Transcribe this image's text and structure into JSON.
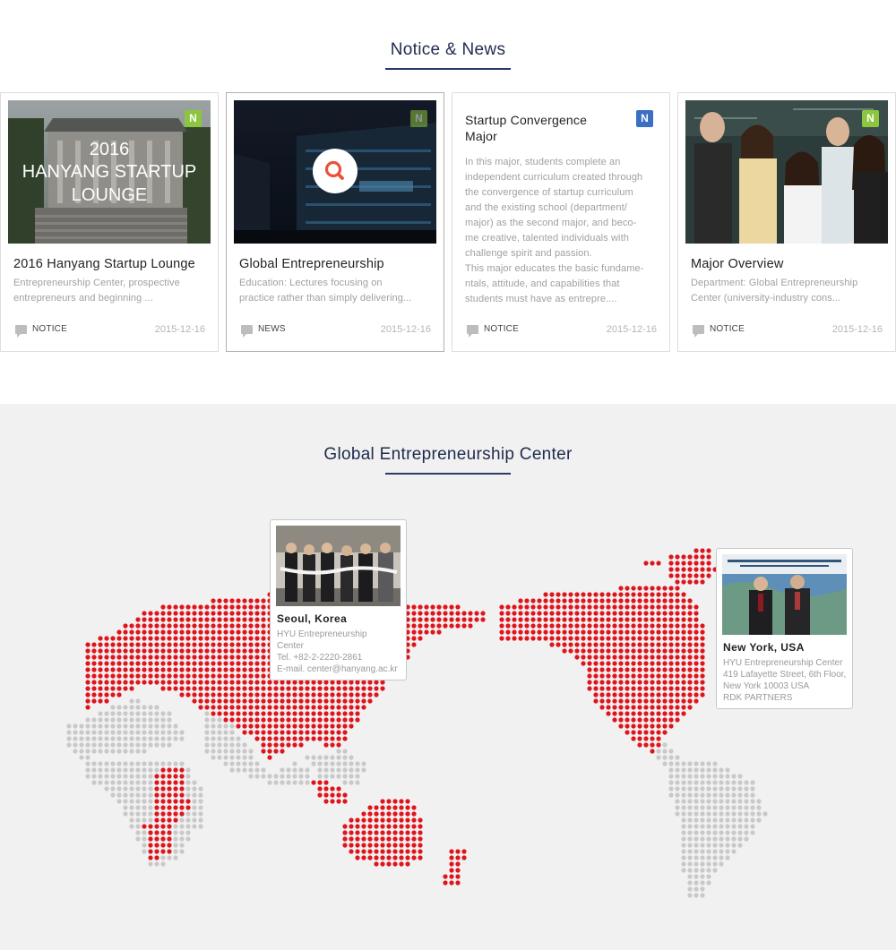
{
  "news": {
    "title": "Notice & News",
    "cards": [
      {
        "badge": "N",
        "thumb_caption": [
          "2016",
          "HANYANG STARTUP",
          "LOUNGE"
        ],
        "title": "2016 Hanyang Startup Lounge",
        "desc": [
          "Entrepreneurship Center, prospective",
          "entrepreneurs and beginning ..."
        ],
        "category": "NOTICE",
        "date": "2015-12-16"
      },
      {
        "badge": "N",
        "title": "Global Entrepreneurship",
        "desc": [
          "Education: Lectures focusing on",
          "practice rather than simply delivering..."
        ],
        "category": "NEWS",
        "date": "2015-12-16"
      },
      {
        "badge": "N",
        "title": [
          "Startup Convergence",
          "Major"
        ],
        "desc": [
          "In this major, students complete an",
          "independent curriculum created through",
          "the convergence of startup curriculum",
          "and the existing school (department/",
          "major) as the second major, and beco-",
          "me creative, talented individuals with",
          "challenge spirit and passion.",
          "This major educates the basic fundame-",
          "ntals, attitude, and capabilities that",
          "students must have as entrepre...."
        ],
        "category": "NOTICE",
        "date": "2015-12-16"
      },
      {
        "badge": "N",
        "title": "Major Overview",
        "desc": [
          "Department: Global Entrepreneurship",
          "Center (university-industry cons..."
        ],
        "category": "NOTICE",
        "date": "2015-12-16"
      }
    ]
  },
  "global": {
    "title": "Global Entrepreneurship Center",
    "locations": [
      {
        "city": "Seoul, Korea",
        "lines": [
          "HYU Entrepreneurship",
          "Center",
          "Tel. +82-2-2220-2861",
          "E-mail. center@hanyang.ac.kr"
        ]
      },
      {
        "city": "New York, USA",
        "lines": [
          "HYU Entrepreneurship Center",
          "419 Lafayette Street, 6th Floor,",
          "New York 10003 USA",
          "RDK PARTNERS"
        ]
      }
    ]
  },
  "colors": {
    "navy": "#1f2a4d",
    "badge_green": "#8cc63f",
    "badge_blue": "#3a6fc4",
    "map_red": "#e0141c",
    "map_gray": "#c9c9c9",
    "search_circle": "#e8533b"
  },
  "icons": [
    "search-icon",
    "notice-icon"
  ]
}
